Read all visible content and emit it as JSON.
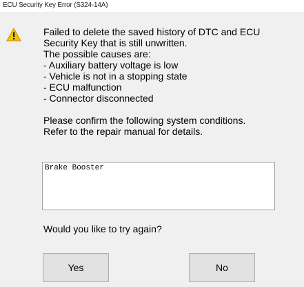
{
  "window": {
    "title": "ECU Security Key Error (S324-14A)"
  },
  "icon": {
    "name": "warning-icon",
    "color": "#f0b400"
  },
  "message": {
    "line1": "Failed to delete the saved history of DTC and ECU",
    "line2": "Security Key that is still unwritten.",
    "line3": "The possible causes are:",
    "causes": [
      " - Auxiliary battery voltage is low",
      " - Vehicle is not in a stopping state",
      " - ECU malfunction",
      " - Connector disconnected"
    ],
    "confirm1": "Please confirm the following system conditions.",
    "confirm2": "Refer to the repair manual for details."
  },
  "systems_list": {
    "items": [
      "Brake Booster"
    ]
  },
  "question": "Would you like to try again?",
  "buttons": {
    "yes": "Yes",
    "no": "No"
  }
}
